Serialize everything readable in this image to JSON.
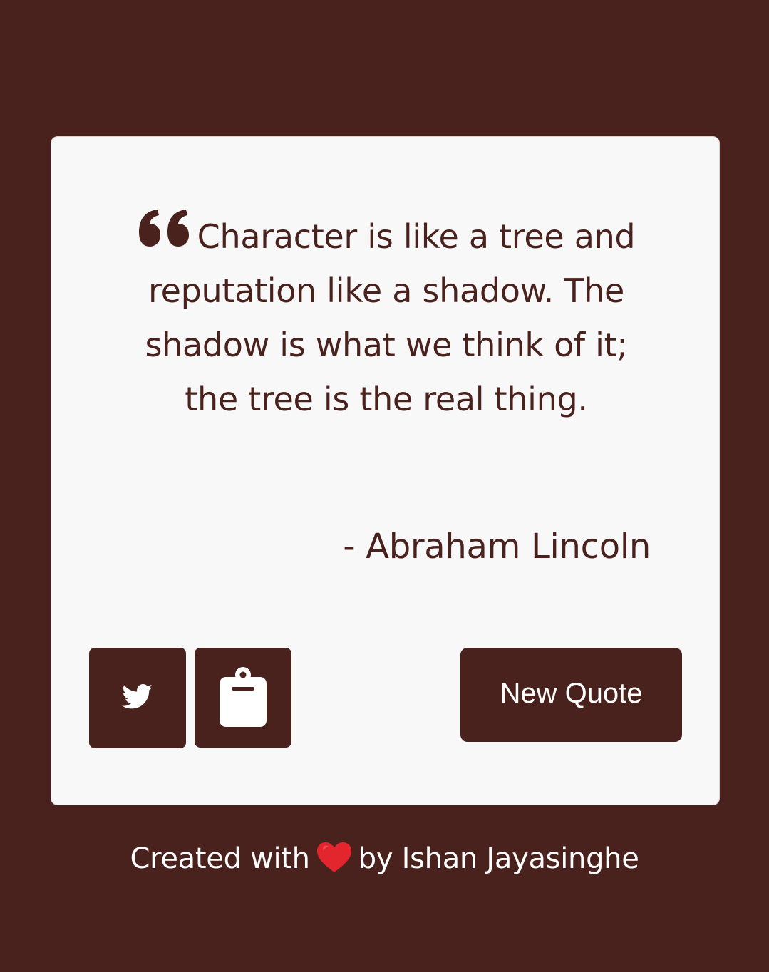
{
  "quote": {
    "text": "Character is like a tree and reputation like a shadow. The shadow is what we think of it; the tree is the real thing.",
    "author": "- Abraham Lincoln"
  },
  "actions": {
    "twitter_icon": "twitter-icon",
    "copy_icon": "clipboard-icon",
    "new_quote_label": "New Quote"
  },
  "footer": {
    "prefix": "Created with",
    "suffix": "by Ishan Jayasinghe"
  },
  "colors": {
    "background": "#4a221d",
    "card": "#f8f8f8",
    "accent": "#4a221d",
    "heart": "#e3262e"
  }
}
